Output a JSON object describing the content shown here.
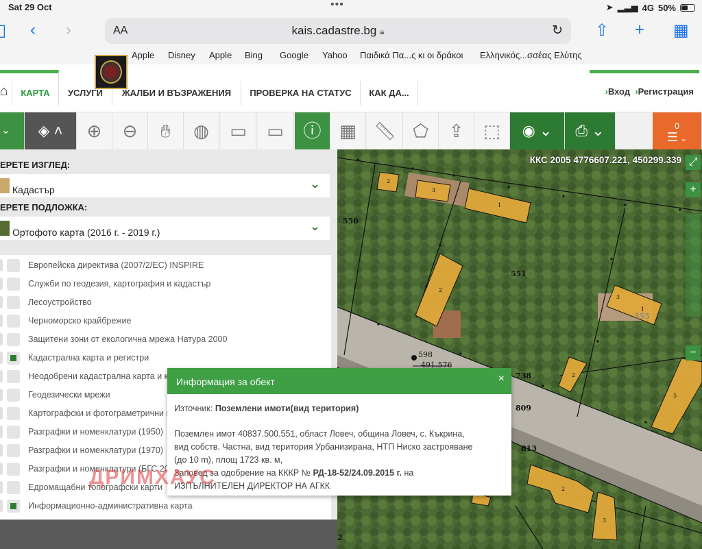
{
  "status_bar": {
    "time": "Sat 29 Oct",
    "network": "4G",
    "battery": "50%"
  },
  "browser": {
    "aa": "AA",
    "url": "kais.cadastre.bg",
    "bookmarks": [
      "Apple",
      "Disney",
      "Apple",
      "Bing",
      "Google",
      "Yahoo",
      "Παιδικά Πα...ς κι οι δράκοι",
      "Ελληνικός...σσέας Ελύτης"
    ]
  },
  "nav": {
    "tabs": [
      "КАРТА",
      "УСЛУГИ",
      "ЖАЛБИ И ВЪЗРАЖЕНИЯ",
      "ПРОВЕРКА НА СТАТУС",
      "КАК ДА..."
    ],
    "login": "Вход",
    "register": "Регистрация"
  },
  "toolbar": {
    "basket_count": "0"
  },
  "panel": {
    "view_label": "ЕРЕТЕ ИЗГЛЕД:",
    "view_value": "Кадастър",
    "base_label": "ЕРЕТЕ ПОДЛОЖКА:",
    "base_value": "Ортофото карта (2016 г. - 2019 г.)",
    "layers": [
      {
        "label": "Европейска директива (2007/2/EC) INSPIRE",
        "checked": false
      },
      {
        "label": "Служби по геодезия, картография и кадастър",
        "checked": false
      },
      {
        "label": "Лесоустройство",
        "checked": false
      },
      {
        "label": "Черноморско крайбрежие",
        "checked": false
      },
      {
        "label": "Защитени зони от екологична мрежа Натура 2000",
        "checked": false
      },
      {
        "label": "Кадастрална карта и регистри",
        "checked": true
      },
      {
        "label": "Неодобрени кадастрална карта и к",
        "checked": false
      },
      {
        "label": "Геодезически мрежи",
        "checked": false
      },
      {
        "label": "Картографски и фотограметрични п",
        "checked": false
      },
      {
        "label": "Разграфки и номенклатури (1950)",
        "checked": false
      },
      {
        "label": "Разграфки и номенклатури (1970)",
        "checked": false
      },
      {
        "label": "Разграфки и номенклатури (БГС 20",
        "checked": false
      },
      {
        "label": "Едромащабни топографски карти",
        "checked": false
      },
      {
        "label": "Информационно-административна карта",
        "checked": true
      }
    ]
  },
  "map": {
    "coordinates": "ККС 2005 4776607.221, 450299.339",
    "labels": [
      "550",
      "551",
      "555",
      "738",
      "809",
      "813",
      "598",
      "491.576",
      "2",
      "3",
      "1",
      "2",
      "3",
      "1",
      "2",
      "5",
      "2",
      "3",
      "2"
    ]
  },
  "popup": {
    "title": "Информация за обект",
    "close": "×",
    "source_label": "Източник:",
    "source_value": "Поземлени имоти(вид територия)",
    "line1": "Поземлен имот 40837.500.551, област Ловеч, община Ловеч, с. Къкрина,",
    "line2": "вид собств. Частна, вид територия Урбанизирана, НТП Ниско застрояване",
    "line3": "(до 10 m), площ 1723 кв. м,",
    "order_prefix": "Заповед за одобрение на КККР №",
    "order_number": "РД-18-52/24.09.2015 г.",
    "order_suffix": "на",
    "line5": "ИЗПЪЛНИТЕЛЕН ДИРЕКТОР НА АГКК"
  },
  "watermark": "ДРИМХАУС"
}
